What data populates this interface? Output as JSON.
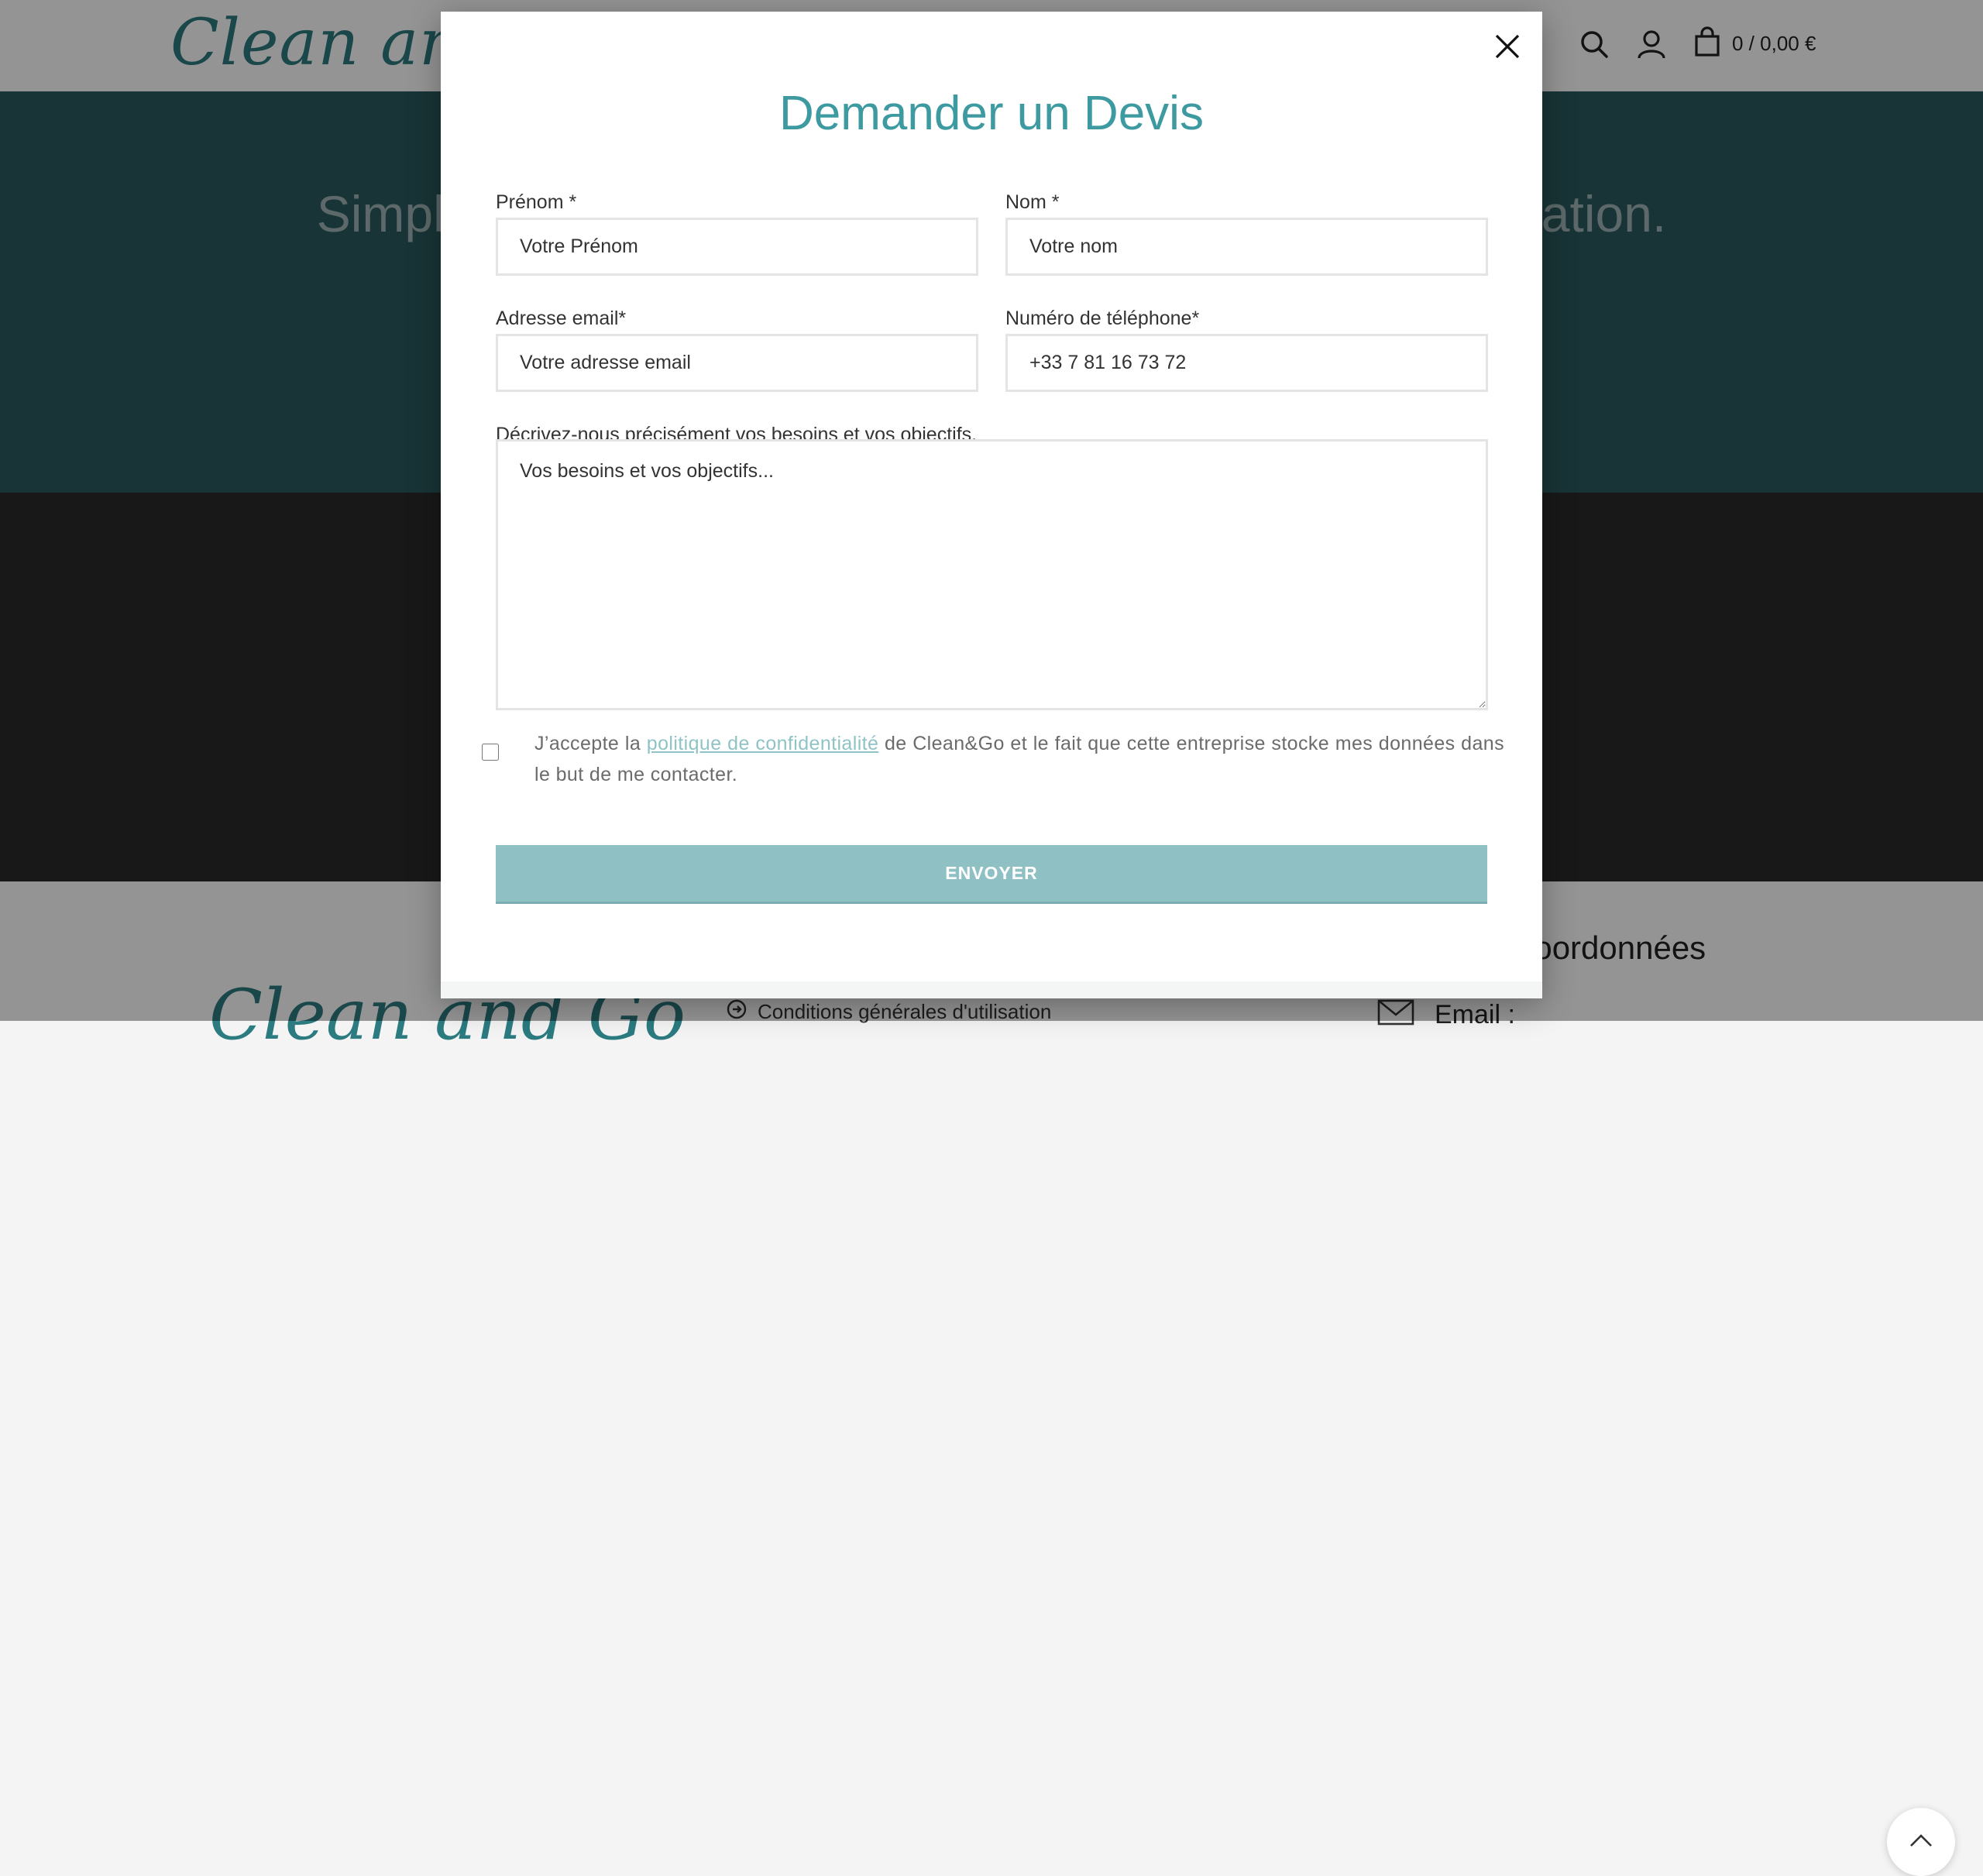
{
  "header": {
    "logo_text": "Clean and Go",
    "cart_summary": "0 / 0,00 €"
  },
  "hero": {
    "text": "Simplifiez votre quotidien avec notre service de réservation."
  },
  "footer": {
    "logo_text": "Clean and Go",
    "link_cgu": "Conditions générales d'utilisation",
    "heading": "Coordonnées",
    "email_label": "Email :"
  },
  "modal": {
    "title": "Demander un Devis",
    "first_name": {
      "label": "Prénom *",
      "placeholder": "Votre Prénom"
    },
    "last_name": {
      "label": "Nom *",
      "placeholder": "Votre nom"
    },
    "email": {
      "label": "Adresse email*",
      "placeholder": "Votre adresse email"
    },
    "phone": {
      "label": "Numéro de téléphone*",
      "placeholder": "+33 7 81 16 73 72"
    },
    "needs": {
      "label": "Décrivez-nous précisément vos besoins et vos objectifs.",
      "placeholder": "Vos besoins et vos objectifs..."
    },
    "consent": {
      "before": "J’accepte la ",
      "link": "politique de confidentialité",
      "after": " de Clean&Go et le fait que cette entreprise stocke mes données dans le but de me contacter."
    },
    "submit_label": "ENVOYER"
  },
  "colors": {
    "accent": "#3c9aa0",
    "button": "#8fc0c4",
    "hero_bg": "#2a5a5e"
  },
  "icons": [
    "search-icon",
    "user-icon",
    "cart-icon",
    "close-icon",
    "chevron-up-icon",
    "arrow-circle-icon",
    "envelope-icon"
  ]
}
